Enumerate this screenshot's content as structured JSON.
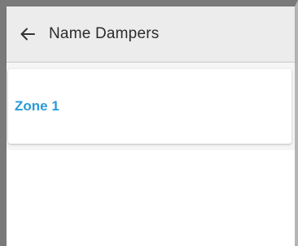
{
  "header": {
    "back_icon": "arrow-left-icon",
    "title": "Name Dampers"
  },
  "zones": [
    {
      "label": "Zone 1",
      "color": "#2a9bd8"
    }
  ]
}
